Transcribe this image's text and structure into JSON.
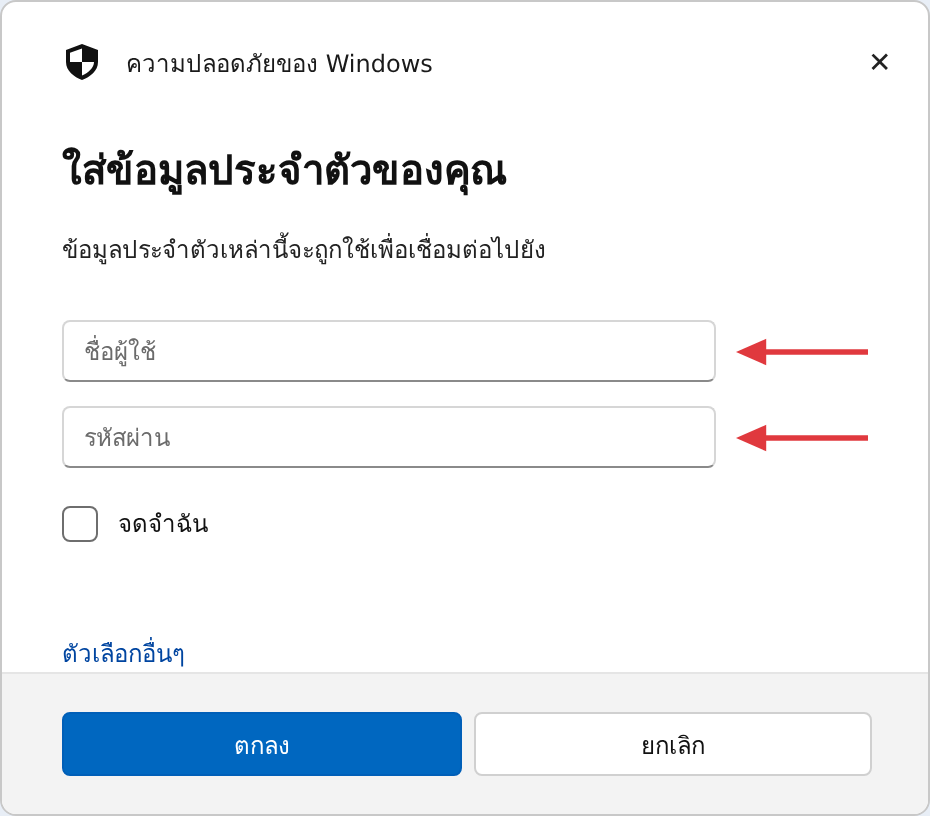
{
  "window": {
    "title": "ความปลอดภัยของ Windows",
    "close": "✕"
  },
  "heading": "ใส่ข้อมูลประจำตัวของคุณ",
  "description": "ข้อมูลประจำตัวเหล่านี้จะถูกใช้เพื่อเชื่อมต่อไปยัง",
  "fields": [
    {
      "placeholder": "ชื่อผู้ใช้"
    },
    {
      "placeholder": "รหัสผ่าน"
    }
  ],
  "remember": {
    "label": "จดจำฉัน",
    "checked": false
  },
  "more_link": "ตัวเลือกอื่นๆ",
  "buttons": [
    {
      "label": "ตกลง",
      "kind": "primary"
    },
    {
      "label": "ยกเลิก",
      "kind": "secondary"
    }
  ]
}
